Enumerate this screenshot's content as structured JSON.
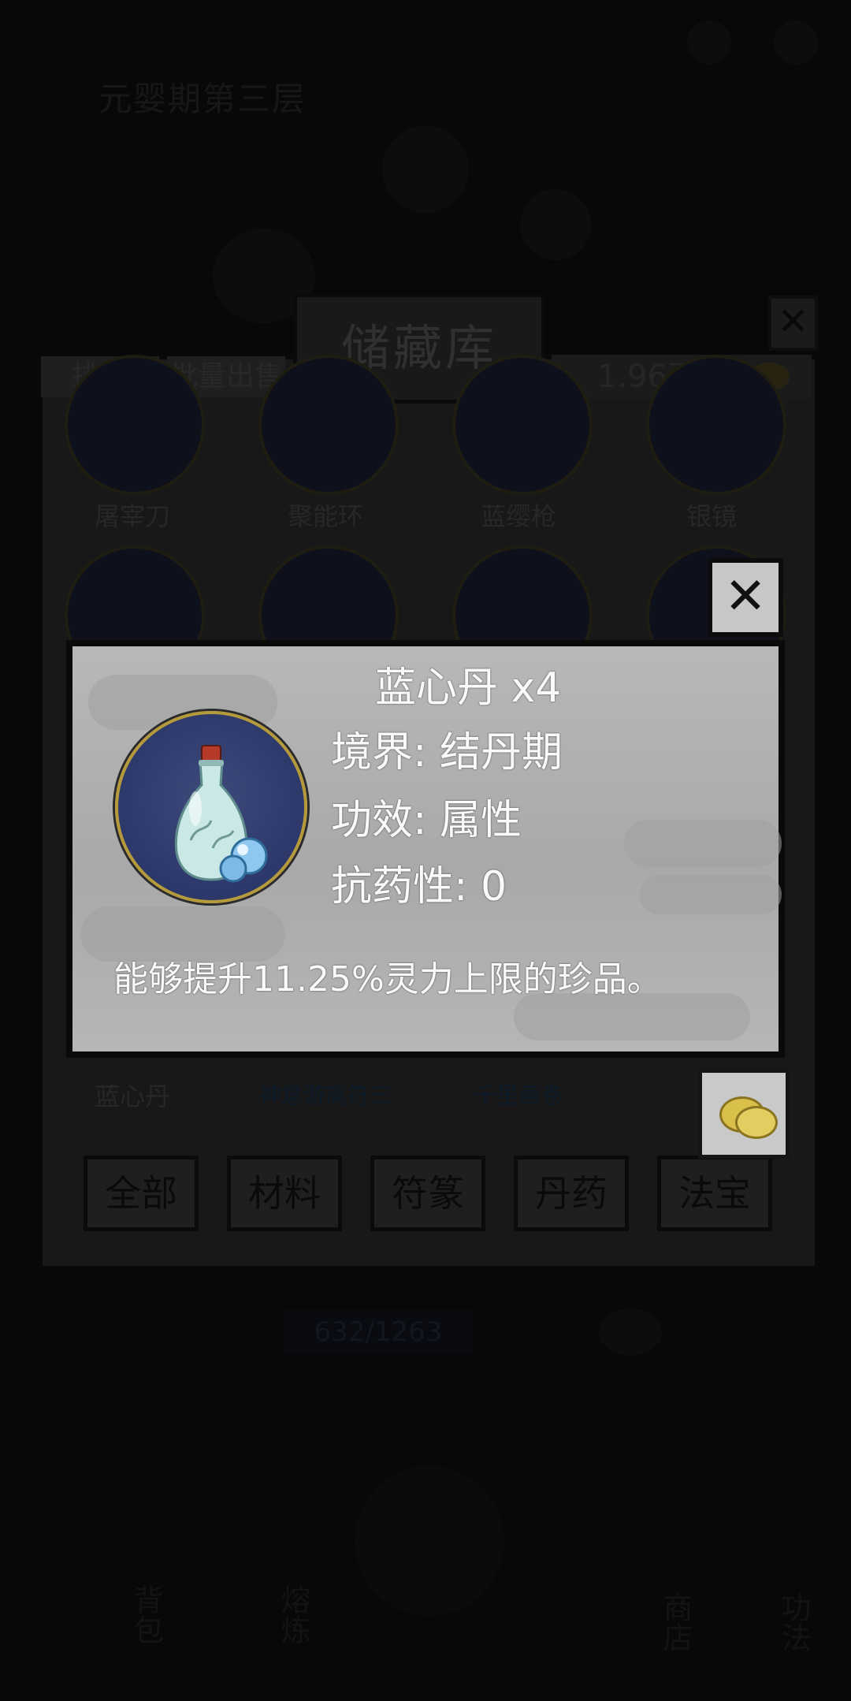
{
  "background": {
    "stage_title": "元婴期第三层",
    "counter": "632/1263",
    "bottom_nav": [
      "背包",
      "熔炼",
      "商店",
      "功法"
    ]
  },
  "storage": {
    "title": "储藏库",
    "sort_label": "排序",
    "batch_sell_label": "批量出售",
    "coins": "1.96万",
    "row1_items": [
      "屠宰刀",
      "聚能环",
      "蓝缨枪",
      "银镜"
    ],
    "bottom_row_items": [
      "蓝心丹",
      "神意游离符三",
      "千里画卷"
    ],
    "tabs": [
      "全部",
      "材料",
      "符篆",
      "丹药",
      "法宝"
    ]
  },
  "popup": {
    "item_name": "蓝心丹 x4",
    "realm": "境界: 结丹期",
    "effect": "功效: 属性",
    "resistance": "抗药性: 0",
    "description": "能够提升11.25%灵力上限的珍品。",
    "item_icon": "blue-porcelain-bottle-with-pearls"
  },
  "colors": {
    "popup_bg": "#b3b3b3",
    "icon_bg": "#2d386a",
    "icon_ring": "#b59a3c",
    "coin_gold": "#d9c04a"
  }
}
